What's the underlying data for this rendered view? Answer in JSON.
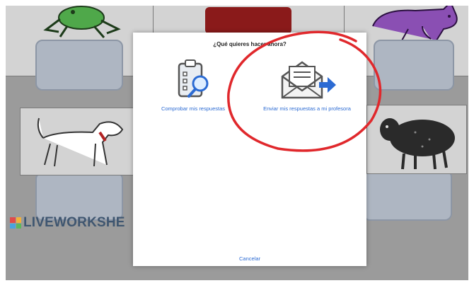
{
  "dialog": {
    "title": "¿Qué quieres hacer ahora?",
    "options": [
      {
        "label": "Comprobar mis respuestas",
        "icon": "clipboard-magnifier-icon"
      },
      {
        "label": "Enviar mis respuestas a mi profesora",
        "icon": "envelope-send-icon"
      }
    ],
    "cancel_label": "Cancelar"
  },
  "brand": {
    "name": "LIVEWORKSHE"
  },
  "colors": {
    "link": "#2c6bd3",
    "annotation": "#e0282c",
    "overlay": "#9b9b9b"
  }
}
